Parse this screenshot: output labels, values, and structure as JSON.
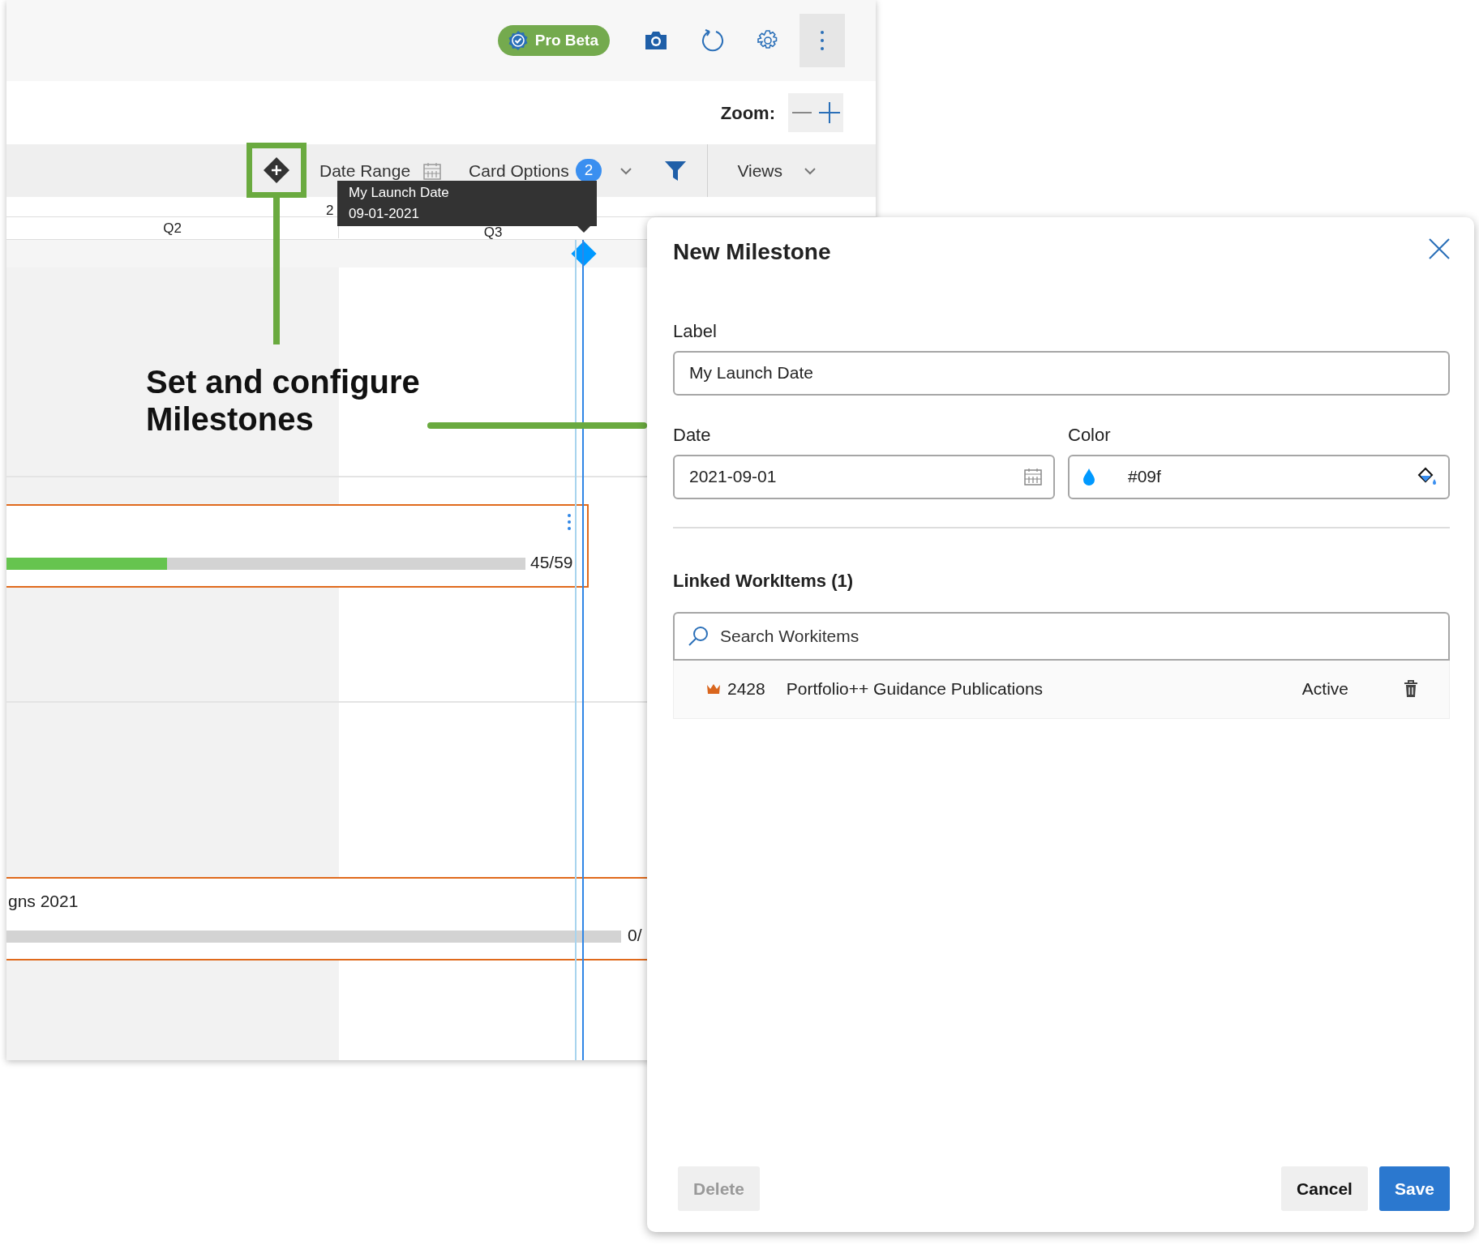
{
  "header": {
    "badge": "Pro Beta"
  },
  "zoom": {
    "label": "Zoom:"
  },
  "toolbar": {
    "milestone_highlighted": true,
    "date_range": "Date Range",
    "card_options": "Card Options",
    "card_options_count": "2",
    "views": "Views"
  },
  "timeline": {
    "year_label": "2",
    "quarters": [
      "Q2",
      "Q3"
    ],
    "cards": [
      {
        "progress": "45/59",
        "level": 0.31
      },
      {
        "title": "gns 2021",
        "progress": "0/"
      }
    ]
  },
  "milestone": {
    "tooltip_label": "My Launch Date",
    "tooltip_date": "09-01-2021"
  },
  "annotation": {
    "text": "Set and configure Milestones"
  },
  "dialog": {
    "title": "New Milestone",
    "label_label": "Label",
    "label_value": "My Launch Date",
    "date_label": "Date",
    "date_value": "2021-09-01",
    "color_label": "Color",
    "color_value": "#09f",
    "linked_title": "Linked WorkItems (1)",
    "search_placeholder": "Search Workitems",
    "items": [
      {
        "id": "2428",
        "title": "Portfolio++ Guidance Publications",
        "state": "Active"
      }
    ],
    "buttons": [
      {
        "label": "Delete",
        "kind": "secondary",
        "disabled": true
      },
      {
        "label": "Cancel",
        "kind": "secondary",
        "disabled": false
      },
      {
        "label": "Save",
        "kind": "primary",
        "disabled": false
      }
    ]
  }
}
